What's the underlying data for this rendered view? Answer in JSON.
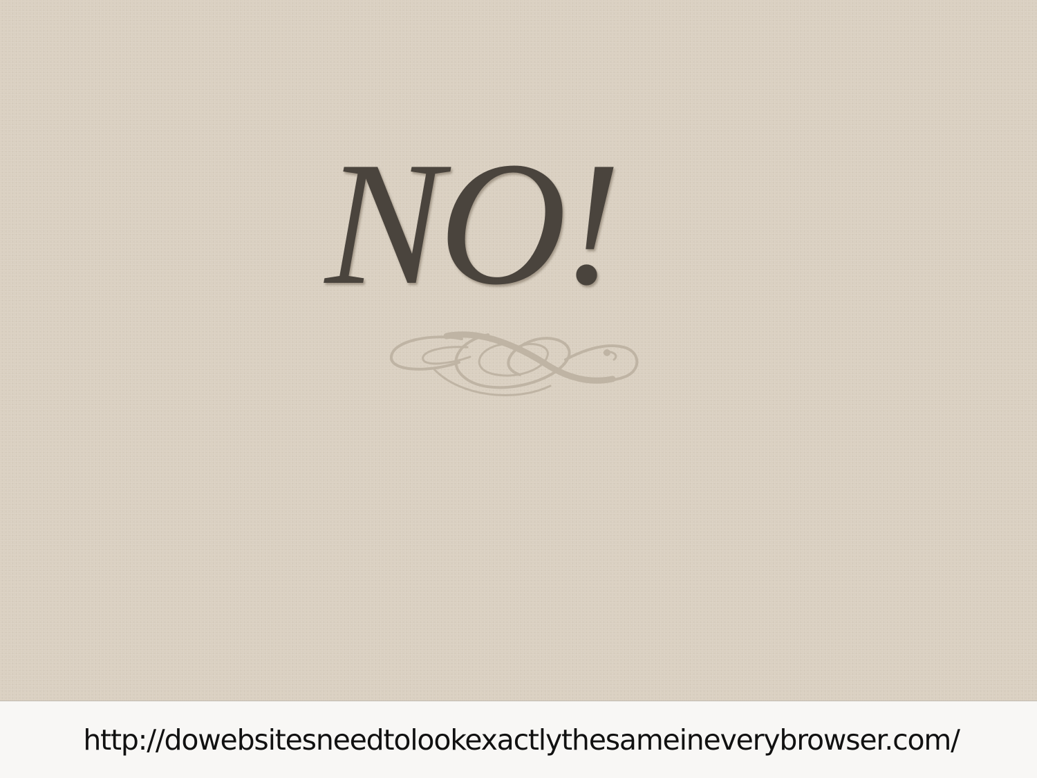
{
  "slide": {
    "headline": "NO!",
    "text_color": "#4a443d",
    "background_color": "#d9cfc0",
    "ornament_icon": "decorative-flourish",
    "ornament_color": "#bfb4a4"
  },
  "footer": {
    "url": "http://dowebsitesneedtolookexactlythesameineverybrowser.com/",
    "background_color": "#f8f7f5"
  }
}
